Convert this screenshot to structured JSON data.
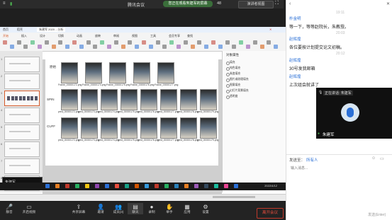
{
  "meeting": {
    "window_title": "腾讯会议",
    "share_status": "您正在观看朱建军的屏幕",
    "speaker_view_button": "演讲者视图",
    "time_label": "48"
  },
  "shared_screen": {
    "wps_tabs": [
      "首页",
      "稻壳",
      "朱建军 2020 ...分析"
    ],
    "ribbon_tabs": [
      "开始",
      "插入",
      "设计",
      "切换",
      "动画",
      "放映",
      "审阅",
      "视图",
      "工具",
      "会员专享",
      "查找"
    ],
    "slide_numbers": [
      "1",
      "2",
      "3",
      "4",
      "5",
      "6",
      "7",
      "8"
    ],
    "row_labels": [
      "原始",
      "SPIN",
      "CUFF"
    ],
    "row1_captions": [
      "Frame_00000172.png",
      "Frame_00000174.png",
      "Frame_00000175.png",
      "Frame_00000176.png",
      "Frame_00000177.png"
    ],
    "row2_captions": [
      "pred_00000172.png",
      "pred_00000173.png",
      "pred_00000174.png",
      "pred_00000175.png",
      "pred_00000176.png",
      "pred_00000177.png",
      "pred_00000178.png",
      "pred_00000179.png"
    ],
    "row3_captions": [
      "pred_00000172.png",
      "pred_00000173.png",
      "pred_00000174.png",
      "pred_00000175.png",
      "pred_00000176.png",
      "pred_00000177.png",
      "pred_00000178.png",
      "pred_00000179.png"
    ],
    "right_panel_title": "对象属性",
    "right_panel_items": [
      "填充",
      "纯色填充",
      "渐变填充",
      "图片或纹理填充",
      "图案填充",
      "幻灯片背景填充",
      "透明度"
    ],
    "mini_window_label": "朱建军...",
    "date_label": "2022/4/12"
  },
  "toolbar": {
    "items": [
      {
        "label": "静音",
        "icon": "mic-icon"
      },
      {
        "label": "开启视频",
        "icon": "camera-icon"
      },
      {
        "label": "共享屏幕",
        "icon": "share-screen-icon"
      },
      {
        "label": "邀请",
        "icon": "invite-icon"
      },
      {
        "label": "成员(3)",
        "icon": "members-icon"
      },
      {
        "label": "聊天",
        "icon": "chat-icon"
      },
      {
        "label": "录制",
        "icon": "record-icon"
      },
      {
        "label": "举手",
        "icon": "raise-hand-icon"
      },
      {
        "label": "应用",
        "icon": "apps-icon"
      },
      {
        "label": "设置",
        "icon": "settings-icon"
      }
    ],
    "end_meeting": "离开会议"
  },
  "chat": {
    "messages": [
      {
        "sender": "朴金明",
        "text": "等一下，等等赵院长，朱教授。",
        "time": "19:11"
      },
      {
        "sender": "赵辉煌",
        "text": "各位要按计划提交论文初稿。",
        "time": "20:03"
      },
      {
        "sender": "赵辉煌",
        "text": "30号发我邮箱",
        "time": "20:12"
      },
      {
        "sender": "赵辉煌",
        "text": "上次组会就讲了",
        "time": ""
      }
    ],
    "video_status": "正在讲话: 朱建军",
    "video_name": "朱建军",
    "send_to_label": "发送至：",
    "send_to_target": "所有人",
    "input_placeholder": "输入消息...",
    "send_label": "发送(Enter)"
  },
  "colors": {
    "accent_blue": "#2a6fd6",
    "share_green": "#3a6e3a",
    "end_red": "#e74c3c",
    "background_dark": "#1f1f1f"
  }
}
